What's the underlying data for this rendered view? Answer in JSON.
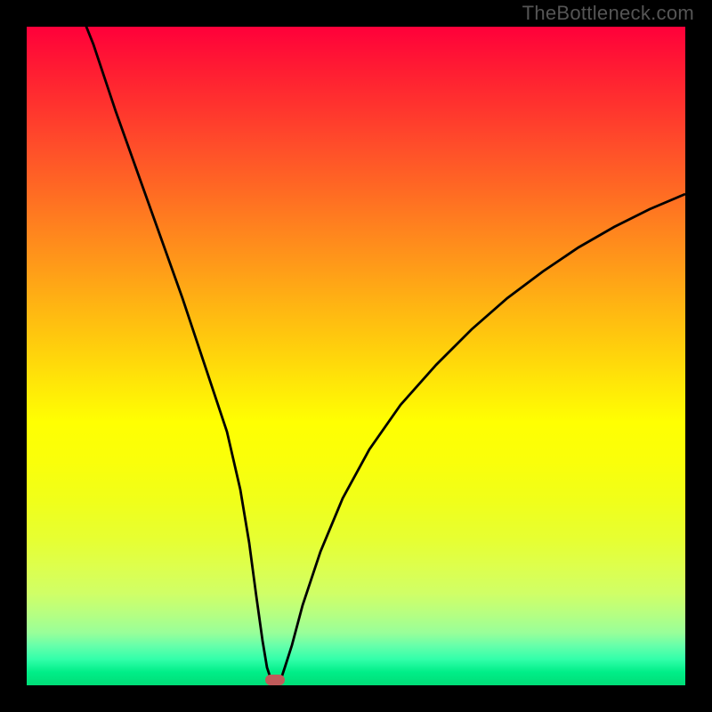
{
  "watermark": "TheBottleneck.com",
  "chart_data": {
    "type": "line",
    "title": "",
    "xlabel": "",
    "ylabel": "",
    "xlim": [
      0,
      100
    ],
    "ylim": [
      0,
      100
    ],
    "x": [
      0,
      4,
      8,
      12,
      16,
      20,
      24,
      28,
      32,
      35,
      36,
      37,
      38,
      40,
      44,
      48,
      52,
      56,
      60,
      64,
      68,
      72,
      76,
      80,
      84,
      88,
      92,
      96,
      100
    ],
    "values": [
      108,
      96,
      84,
      72,
      60,
      48,
      36,
      24,
      12,
      2,
      0.5,
      0.5,
      2,
      8,
      20,
      30,
      38,
      45,
      51,
      56,
      60.5,
      64.5,
      68,
      71,
      73.8,
      76.2,
      78.4,
      80.3,
      82
    ],
    "minimum_marker": {
      "x": 36.5,
      "y": 0
    },
    "background_gradient_stops": [
      {
        "pos": 0,
        "color": "#ff003a"
      },
      {
        "pos": 50,
        "color": "#ffd500"
      },
      {
        "pos": 100,
        "color": "#00dd77"
      }
    ]
  }
}
